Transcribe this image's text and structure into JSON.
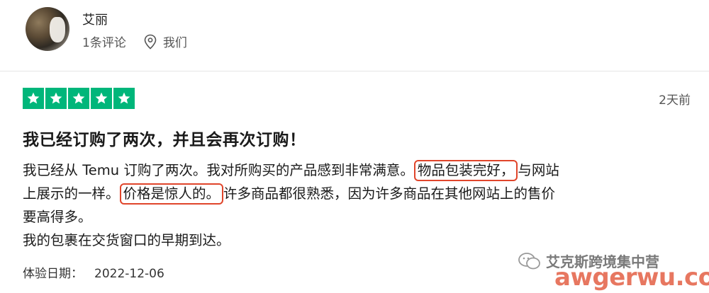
{
  "reviewer": {
    "name": "艾丽",
    "review_count": "1条评论",
    "location": "我们"
  },
  "review": {
    "rating_stars": 5,
    "date_ago": "2天前",
    "title": "我已经订购了两次，并且会再次订购！",
    "line1_pre": "我已经从 Temu 订购了两次。我对所购买的产品感到非常满意。",
    "line1_hl": "物品包装完好，",
    "line1_post": "与网站",
    "line2_pre": "上展示的一样。",
    "line2_hl": "价格是惊人的。",
    "line2_post": "许多商品都很熟悉，因为许多商品在其他网站上的售价",
    "line3": "要高得多。",
    "line4": "我的包裹在交货窗口的早期到达。",
    "experience_label": "体验日期：",
    "experience_date": "2022-12-06"
  },
  "watermark": {
    "text": "艾克斯跨境集中营",
    "url": "awgerwu.com"
  },
  "colors": {
    "star_green": "#00b67a",
    "highlight_red": "#e0452b"
  }
}
